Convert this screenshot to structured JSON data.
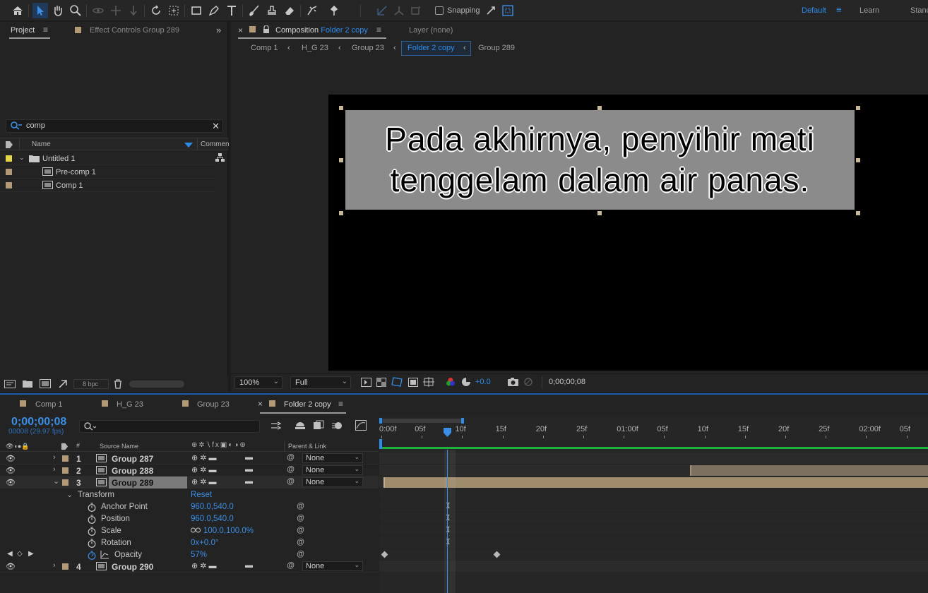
{
  "toolbar": {
    "snapping_label": "Snapping",
    "workspaces": {
      "default": "Default",
      "learn": "Learn",
      "standard": "Stanc"
    }
  },
  "project_panel": {
    "tab_project": "Project",
    "tab_effect_controls": "Effect Controls",
    "effect_controls_target": "Group 289",
    "search_value": "comp",
    "columns": {
      "name": "Name",
      "comment": "Commen"
    },
    "items": [
      {
        "label": "Untitled 1",
        "type": "folder",
        "color": "#e6d54a"
      },
      {
        "label": "Pre-comp 1",
        "type": "composition",
        "color": "#b39a77"
      },
      {
        "label": "Comp 1",
        "type": "composition",
        "color": "#b39a77"
      }
    ],
    "bpc_label": "8 bpc"
  },
  "composition_panel": {
    "tab_prefix": "Composition",
    "tab_name": "Folder 2 copy",
    "layer_tab": "Layer (none)",
    "breadcrumbs": [
      "Comp 1",
      "H_G 23",
      "Group 23",
      "Folder 2 copy",
      "Group 289"
    ],
    "active_crumb": "Folder 2 copy",
    "subtitle_line1": "Pada akhirnya, penyihir mati",
    "subtitle_line2": "tenggelam dalam air panas.",
    "zoom": "100%",
    "resolution": "Full",
    "exposure": "+0.0",
    "timecode": "0;00;00;08"
  },
  "timeline": {
    "tabs": [
      "Comp 1",
      "H_G 23",
      "Group 23",
      "Folder 2 copy"
    ],
    "active_tab": "Folder 2 copy",
    "timecode": "0;00;00;08",
    "fps": "00008 (29.97 fps)",
    "columns": {
      "source_name": "Source Name",
      "parent_link": "Parent & Link"
    },
    "layers": [
      {
        "num": "1",
        "name": "Group 287",
        "parent": "None"
      },
      {
        "num": "2",
        "name": "Group 288",
        "parent": "None"
      },
      {
        "num": "3",
        "name": "Group 289",
        "parent": "None"
      },
      {
        "num": "4",
        "name": "Group 290",
        "parent": "None"
      }
    ],
    "transform_label": "Transform",
    "reset_label": "Reset",
    "properties": [
      {
        "name": "Anchor Point",
        "value": "960.0,540.0"
      },
      {
        "name": "Position",
        "value": "960.0,540.0"
      },
      {
        "name": "Scale",
        "value": "100.0,100.0%"
      },
      {
        "name": "Rotation",
        "value": "0x+0.0°"
      },
      {
        "name": "Opacity",
        "value": "57%"
      }
    ],
    "ruler": [
      "0:00f",
      "05f",
      "10f",
      "15f",
      "20f",
      "25f",
      "01:00f",
      "05f",
      "10f",
      "15f",
      "20f",
      "25f",
      "02:00f",
      "05f"
    ]
  },
  "colors": {
    "accent_blue": "#2d8ceb",
    "label_tan": "#b39a77",
    "label_yellow": "#e6d54a",
    "green_bar": "#1db33a"
  }
}
